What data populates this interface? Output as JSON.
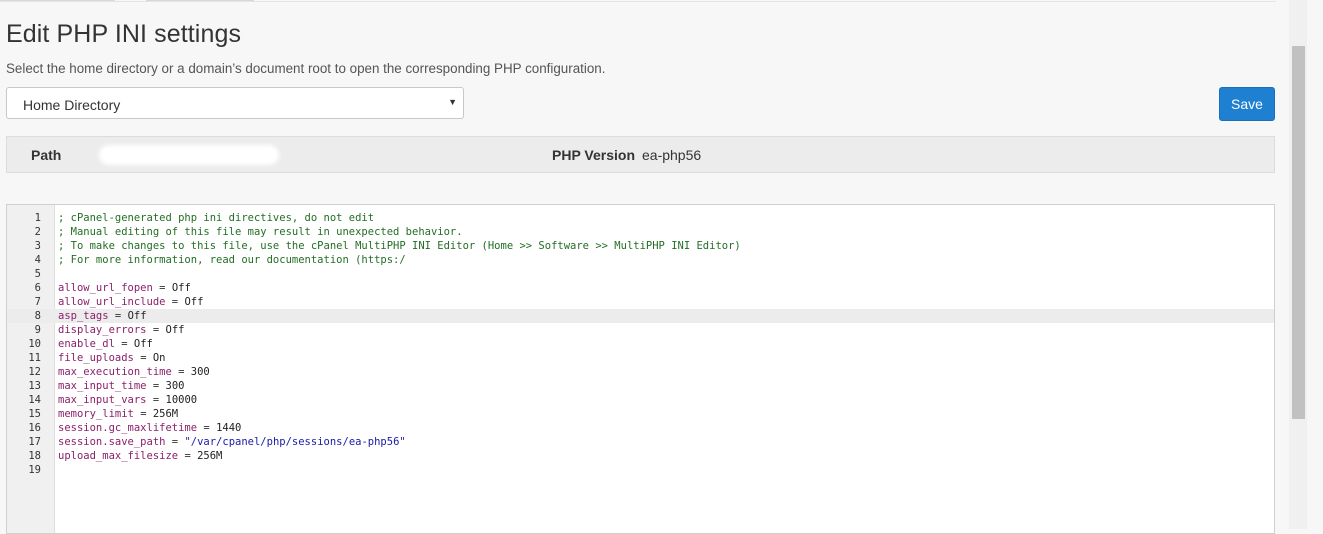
{
  "page": {
    "title": "Edit PHP INI settings",
    "subtitle": "Select the home directory or a domain’s document root to open the corresponding PHP configuration."
  },
  "location_select": {
    "selected": "Home Directory",
    "caret": "▼"
  },
  "save_button": {
    "label": "Save"
  },
  "info_bar": {
    "path_label": "Path",
    "php_version_label": "PHP Version",
    "php_version_value": "ea-php56"
  },
  "editor": {
    "active_line": 8,
    "lines": [
      {
        "num": "1",
        "comment": "; cPanel-generated php ini directives, do not edit"
      },
      {
        "num": "2",
        "comment": "; Manual editing of this file may result in unexpected behavior."
      },
      {
        "num": "3",
        "comment": "; To make changes to this file, use the cPanel MultiPHP INI Editor (Home >> Software >> MultiPHP INI Editor)"
      },
      {
        "num": "4",
        "comment": "; For more information, read our documentation (https:/"
      },
      {
        "num": "5"
      },
      {
        "num": "6",
        "key": "allow_url_fopen",
        "value": "Off"
      },
      {
        "num": "7",
        "key": "allow_url_include",
        "value": "Off"
      },
      {
        "num": "8",
        "key": "asp_tags",
        "value": "Off"
      },
      {
        "num": "9",
        "key": "display_errors",
        "value": "Off"
      },
      {
        "num": "10",
        "key": "enable_dl",
        "value": "Off"
      },
      {
        "num": "11",
        "key": "file_uploads",
        "value": "On"
      },
      {
        "num": "12",
        "key": "max_execution_time",
        "value": "300"
      },
      {
        "num": "13",
        "key": "max_input_time",
        "value": "300"
      },
      {
        "num": "14",
        "key": "max_input_vars",
        "value": "10000"
      },
      {
        "num": "15",
        "key": "memory_limit",
        "value": "256M"
      },
      {
        "num": "16",
        "key": "session.gc_maxlifetime",
        "value": "1440"
      },
      {
        "num": "17",
        "key": "session.save_path",
        "string": "\"/var/cpanel/php/sessions/ea-php56\""
      },
      {
        "num": "18",
        "key": "upload_max_filesize",
        "value": "256M"
      },
      {
        "num": "19"
      }
    ],
    "equals": "="
  }
}
